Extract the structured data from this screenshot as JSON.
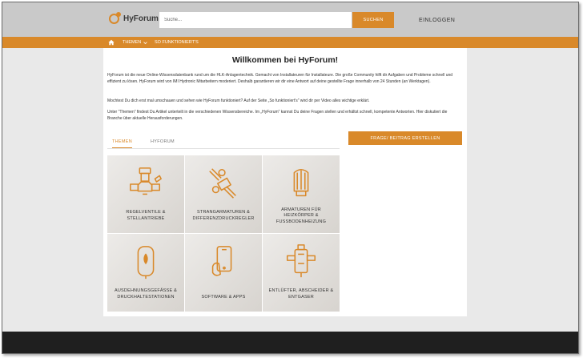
{
  "header": {
    "logo_text": "HyForum",
    "search_placeholder": "Suche...",
    "search_button": "SUCHEN",
    "login": "EINLOGGEN"
  },
  "nav": {
    "themen": "THEMEN",
    "funktioniert": "SO FUNKTIONIERT'S"
  },
  "main": {
    "title": "Willkommen bei HyForum!",
    "intro_1": "HyForum ist die neue Online-Wissensdatenbank rund um die HLK-Anlagentechnik. Gemacht von Installateuren für Installateure. Die große Community hilft dir Aufgaben und Probleme schnell und effizient zu lösen. HyForum wird von IMI Hydronic Mitarbeitern moderiert. Deshalb garantieren wir dir eine Antwort auf deine gestellte Frage innerhalb von 24 Stunden (an Werktagen).",
    "intro_2": "Mochtest Du dich erst mal umschauen und sehen wie HyForum funktioniert? Auf der Seite „So funktioniert's\" wird dir per Video alles wichtige erklärt.",
    "intro_3": "Unter \"Themen\" findest Du Artikel unterteilt in die verschiedenen Wissensbereiche. Im „HyForum\" kannst Du deine Fragen stellen und erhältst schnell, kompetente Antworten. Hier diskutiert die Branche über aktuelle Herausforderungen.",
    "tabs": [
      "THEMEN",
      "HYFORUM"
    ],
    "create_button": "FRAGE/ BEITRAG ERSTELLEN",
    "tiles": [
      {
        "label": "REGELVENTILE & STELLANTRIEBE",
        "icon": "valve-actuator-icon"
      },
      {
        "label": "STRANGARMATUREN & DIFFERENZDRUCKREGLER",
        "icon": "balancing-valve-icon"
      },
      {
        "label": "ARMATUREN FÜR HEIZKÖRPER & FUSSBODENHEIZUNG",
        "icon": "thermostatic-head-icon"
      },
      {
        "label": "AUSDEHNUNGSGEFÄSSE & DRUCKHALTESTATIONEN",
        "icon": "expansion-vessel-icon"
      },
      {
        "label": "SOFTWARE & APPS",
        "icon": "smartphone-icon"
      },
      {
        "label": "ENTLÜFTER, ABSCHEIDER & ENTGASER",
        "icon": "separator-icon"
      }
    ]
  },
  "colors": {
    "accent": "#d9892a",
    "topbar": "#c9c9c9",
    "footer": "#1f1f1f"
  }
}
